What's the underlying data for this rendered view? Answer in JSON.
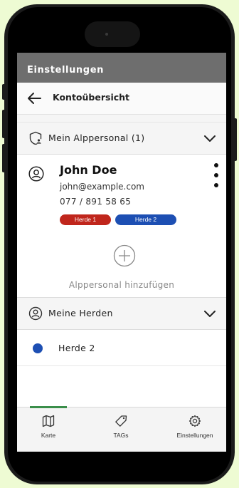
{
  "app_bar": {
    "title": "Einstellungen"
  },
  "sub_header": {
    "title": "Kontoübersicht"
  },
  "personnel_section": {
    "label": "Mein Alppersonal (1)",
    "person": {
      "name": "John Doe",
      "email": "john@example.com",
      "phone": "077 / 891 58 65",
      "herds": [
        {
          "label": "Herde 1",
          "color": "#c0261c"
        },
        {
          "label": "Herde 2",
          "color": "#1d4fb3"
        }
      ]
    },
    "add_label": "Alppersonal hinzufügen"
  },
  "herds_section": {
    "label": "Meine Herden",
    "items": [
      {
        "label": "Herde 2",
        "color": "#1d4fb3"
      }
    ]
  },
  "bottom_nav": {
    "items": [
      {
        "label": "Karte",
        "icon": "map-icon",
        "active": true
      },
      {
        "label": "TAGs",
        "icon": "tag-icon",
        "active": false
      },
      {
        "label": "Einstellungen",
        "icon": "gear-icon",
        "active": false
      }
    ]
  },
  "colors": {
    "accent": "#3a8e4a",
    "app_bar": "#6e6e6e"
  }
}
